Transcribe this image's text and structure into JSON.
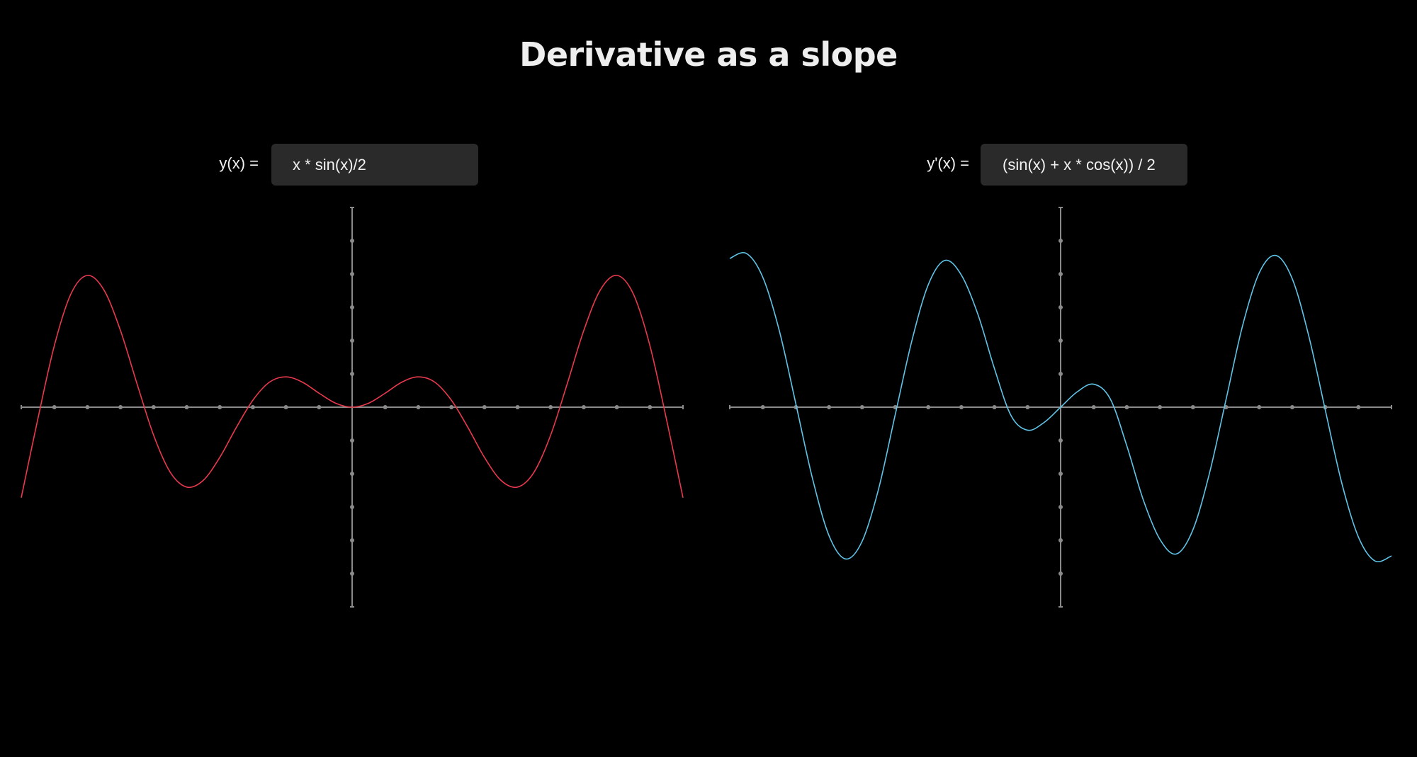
{
  "page": {
    "title": "Derivative as a slope"
  },
  "left_panel": {
    "label": "y(x) =",
    "expression": "x * sin(x)/2"
  },
  "right_panel": {
    "label": "y'(x) =",
    "expression": "(sin(x) + x * cos(x)) / 2"
  },
  "colors": {
    "background": "#000000",
    "function_curve": "#e8394d",
    "derivative_curve": "#5fc4e8",
    "axis": "#8a8a8a",
    "input_bg": "#2a2a2a"
  },
  "chart_data": [
    {
      "type": "line",
      "title": "",
      "xlabel": "",
      "ylabel": "",
      "xlim": [
        -10,
        10
      ],
      "ylim": [
        -6,
        6
      ],
      "grid": false,
      "tick_step": 1,
      "series": [
        {
          "expression": "x * sin(x)/2",
          "x": [
            -10,
            -9.5,
            -9,
            -8.5,
            -8,
            -7.5,
            -7,
            -6.5,
            -6,
            -5.5,
            -5,
            -4.5,
            -4,
            -3.5,
            -3,
            -2.5,
            -2,
            -1.5,
            -1,
            -0.5,
            0,
            0.5,
            1,
            1.5,
            2,
            2.5,
            3,
            3.5,
            4,
            4.5,
            5,
            5.5,
            6,
            6.5,
            7,
            7.5,
            8,
            8.5,
            9,
            9.5,
            10
          ],
          "y": [
            -2.72,
            -0.36,
            1.85,
            3.4,
            3.96,
            3.52,
            2.3,
            0.7,
            -0.84,
            -1.95,
            -2.4,
            -2.2,
            -1.51,
            -0.61,
            0.21,
            0.75,
            0.91,
            0.75,
            0.42,
            0.12,
            0.0,
            0.12,
            0.42,
            0.75,
            0.91,
            0.75,
            0.21,
            -0.61,
            -1.51,
            -2.2,
            -2.4,
            -1.95,
            -0.84,
            0.7,
            2.3,
            3.52,
            3.96,
            3.4,
            1.85,
            -0.36,
            -2.72
          ],
          "color": "#e8394d"
        }
      ]
    },
    {
      "type": "line",
      "title": "",
      "xlabel": "",
      "ylabel": "",
      "xlim": [
        -10,
        10
      ],
      "ylim": [
        -6,
        6
      ],
      "grid": false,
      "tick_step": 1,
      "series": [
        {
          "expression": "(sin(x) + x * cos(x)) / 2",
          "x": [
            -10,
            -9.5,
            -9,
            -8.5,
            -8,
            -7.5,
            -7,
            -6.5,
            -6,
            -5.5,
            -5,
            -4.5,
            -4,
            -3.5,
            -3,
            -2.5,
            -2,
            -1.5,
            -1,
            -0.5,
            0,
            0.5,
            1,
            1.5,
            2,
            2.5,
            3,
            3.5,
            4,
            4.5,
            5,
            5.5,
            6,
            6.5,
            7,
            7.5,
            8,
            8.5,
            9,
            9.5,
            10
          ],
          "y": [
            4.47,
            4.62,
            3.9,
            2.29,
            0.09,
            -2.14,
            -3.86,
            -4.56,
            -4.03,
            -2.45,
            -0.23,
            1.98,
            3.68,
            4.41,
            3.97,
            2.79,
            1.16,
            -0.25,
            -0.69,
            -0.46,
            0.0,
            0.46,
            0.69,
            0.25,
            -1.16,
            -2.79,
            -3.97,
            -4.41,
            -3.68,
            -1.98,
            0.23,
            2.45,
            4.03,
            4.56,
            3.86,
            2.14,
            -0.09,
            -2.29,
            -3.9,
            -4.62,
            -4.47
          ],
          "color": "#5fc4e8"
        }
      ]
    }
  ]
}
